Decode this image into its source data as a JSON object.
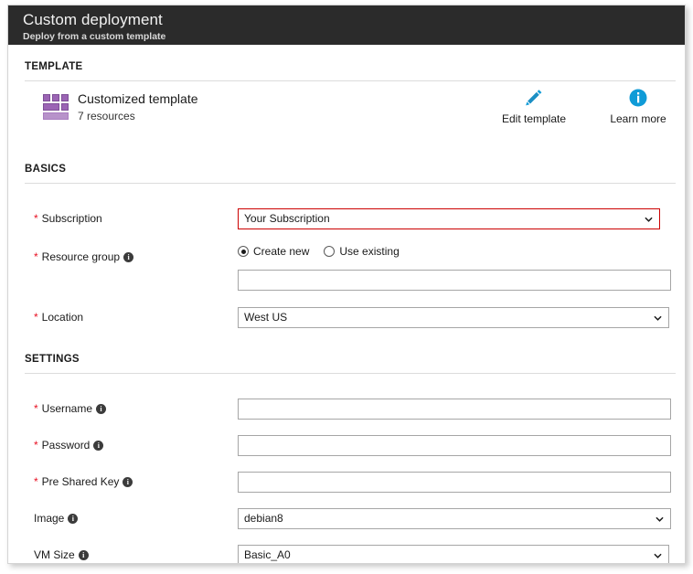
{
  "window": {
    "title": "Custom deployment",
    "subtitle": "Deploy from a custom template"
  },
  "sections": {
    "template": {
      "heading": "TEMPLATE",
      "name": "Customized template",
      "resources": "7 resources",
      "actions": [
        {
          "label": "Edit template",
          "icon": "pencil-icon",
          "color": "#0f9bd7"
        },
        {
          "label": "Learn more",
          "icon": "info-circle-icon",
          "color": "#0f9bd7"
        }
      ]
    },
    "basics": {
      "heading": "BASICS",
      "subscription": {
        "label": "Subscription",
        "required": "*",
        "value": "Your Subscription",
        "invalid": true
      },
      "resource_group": {
        "label": "Resource group",
        "required": "*",
        "options": [
          {
            "label": "Create new",
            "selected": true
          },
          {
            "label": "Use existing",
            "selected": false
          }
        ],
        "value": "",
        "placeholder": ""
      },
      "location": {
        "label": "Location",
        "required": "*",
        "value": "West US"
      }
    },
    "settings": {
      "heading": "SETTINGS",
      "username": {
        "label": "Username",
        "required": "*",
        "value": "",
        "placeholder": ""
      },
      "password": {
        "label": "Password",
        "required": "*",
        "value": "",
        "placeholder": ""
      },
      "pre_shared_key": {
        "label": "Pre Shared Key",
        "required": "*",
        "value": "",
        "placeholder": ""
      },
      "image": {
        "label": "Image",
        "required": "",
        "value": "debian8"
      },
      "vm_size": {
        "label": "VM Size",
        "required": "",
        "value": "Basic_A0"
      }
    }
  },
  "icons": {
    "info_char": "i"
  },
  "colors": {
    "titlebar": "#2b2b2b",
    "accent_blue": "#0f9bd7",
    "required_red": "#e81123",
    "error_border": "#cc0000",
    "template_purple": "#9b64b4"
  }
}
